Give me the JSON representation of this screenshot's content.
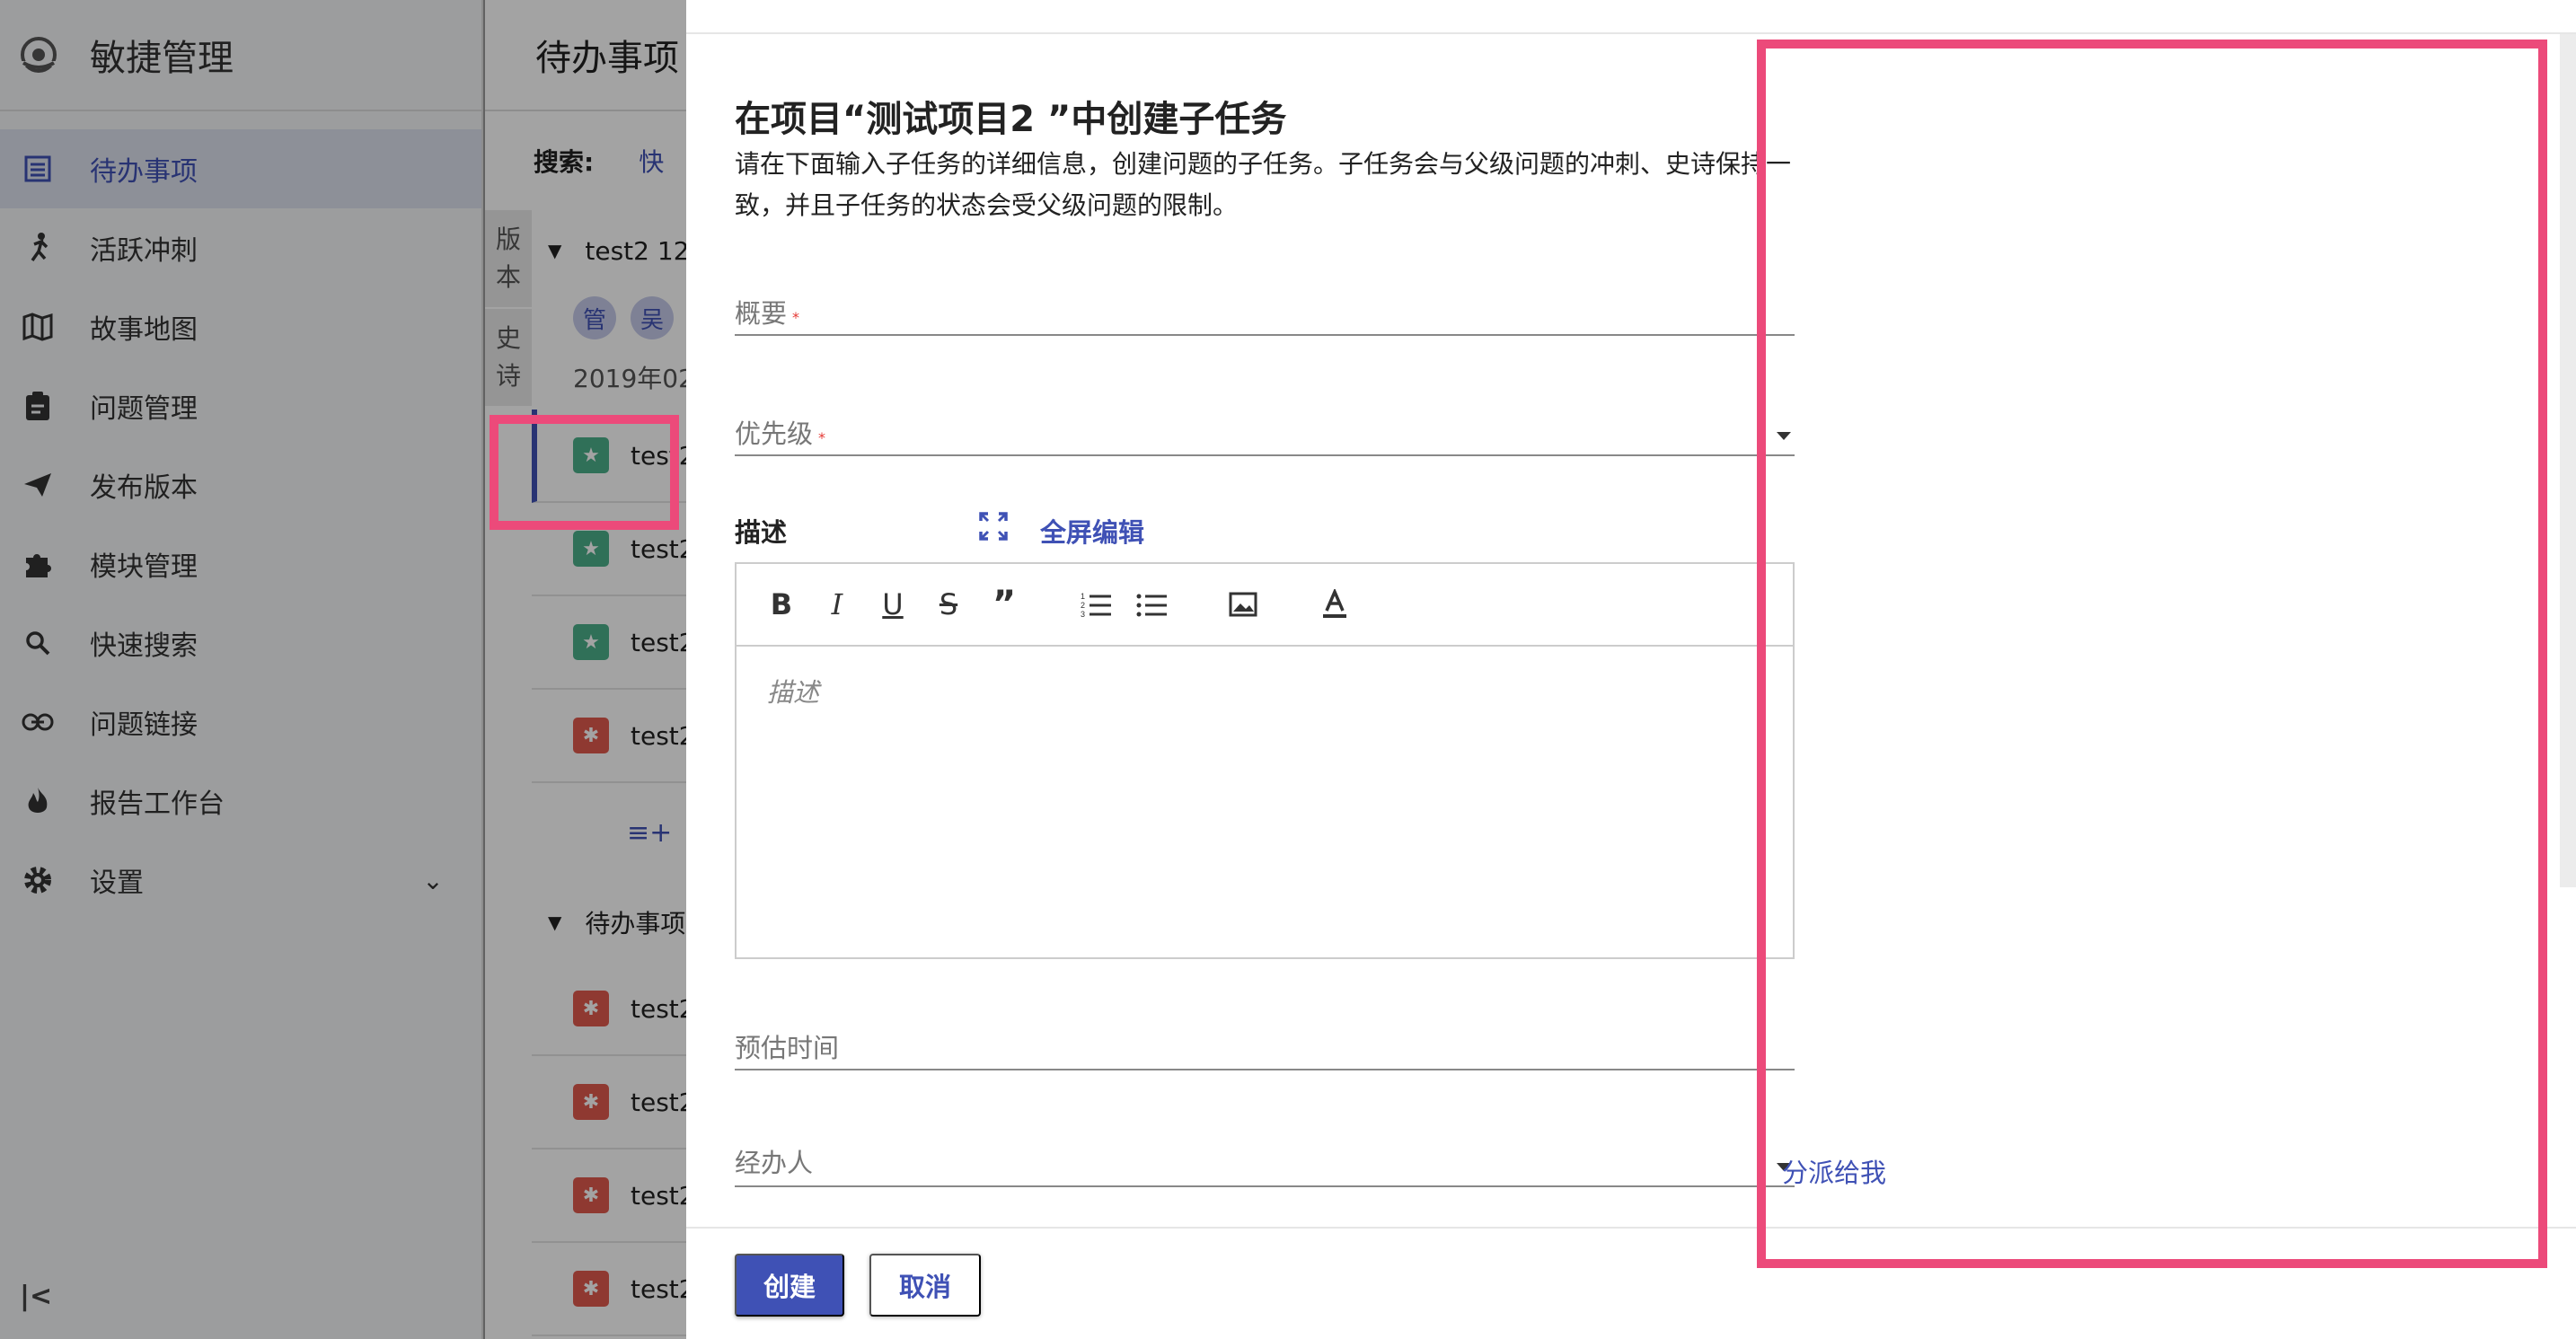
{
  "sidebar": {
    "app_title": "敏捷管理",
    "items": [
      {
        "label": "待办事项",
        "icon": "list-icon"
      },
      {
        "label": "活跃冲刺",
        "icon": "run-icon"
      },
      {
        "label": "故事地图",
        "icon": "map-icon"
      },
      {
        "label": "问题管理",
        "icon": "clipboard-icon"
      },
      {
        "label": "发布版本",
        "icon": "send-icon"
      },
      {
        "label": "模块管理",
        "icon": "puzzle-icon"
      },
      {
        "label": "快速搜索",
        "icon": "search-icon"
      },
      {
        "label": "问题链接",
        "icon": "link-icon"
      },
      {
        "label": "报告工作台",
        "icon": "fire-icon"
      },
      {
        "label": "设置",
        "icon": "gear-icon"
      }
    ],
    "collapse_icon": "collapse-icon"
  },
  "background": {
    "page_title": "待办事项",
    "search_label": "搜索:",
    "search_link": "快",
    "vtabs": [
      [
        "版",
        "本"
      ],
      [
        "史",
        "诗"
      ]
    ],
    "group1": "test2 12",
    "avatars": [
      "管",
      "吴"
    ],
    "date": "2019年02",
    "issues": [
      "test2",
      "test2",
      "test2",
      "test2"
    ],
    "group2": "待办事项",
    "backlog_issues": [
      "test2",
      "test2",
      "test2",
      "test2"
    ]
  },
  "dialog": {
    "title": "在项目“测试项目2 ”中创建子任务",
    "description": "请在下面输入子任务的详细信息，创建问题的子任务。子任务会与父级问题的冲刺、史诗保持一致，并且子任务的状态会受父级问题的限制。",
    "summary_label": "概要",
    "priority_label": "优先级",
    "required_mark": "*",
    "desc_label": "描述",
    "fullscreen_label": "全屏编辑",
    "editor_placeholder": "描述",
    "estimate_label": "预估时间",
    "assignee_label": "经办人",
    "assign_me": "分派给我",
    "create_button": "创建",
    "cancel_button": "取消"
  },
  "colors": {
    "accent": "#3f51b5",
    "highlight": "#ec4a7a",
    "story": "#4caf8a",
    "bug": "#e05a4e"
  }
}
